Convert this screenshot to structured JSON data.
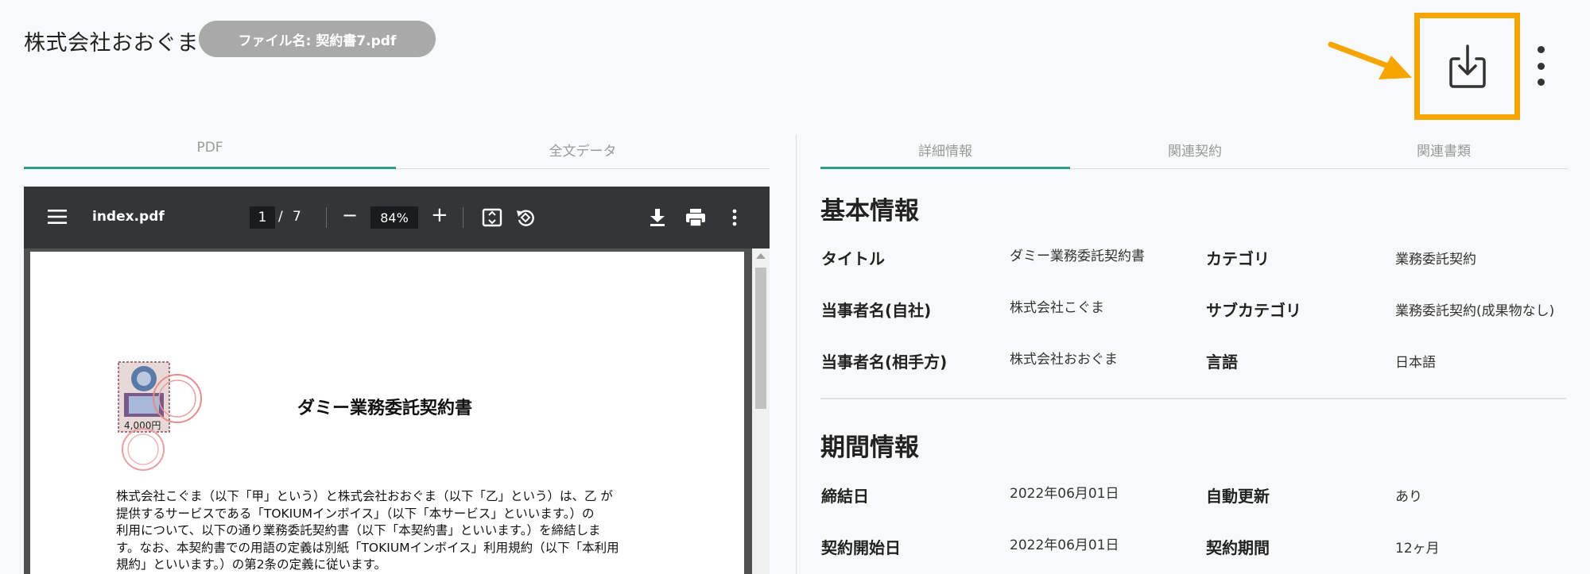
{
  "header": {
    "company": "株式会社おおぐま",
    "file_chip": "ファイル名: 契約書7.pdf"
  },
  "colors": {
    "accent_teal": "#2a9d8f",
    "highlight_orange": "#f6a400",
    "viewer_toolbar": "#323639"
  },
  "left_tabs": [
    {
      "label": "PDF"
    },
    {
      "label": "全文データ"
    }
  ],
  "right_tabs": [
    {
      "label": "詳細情報"
    },
    {
      "label": "関連契約"
    },
    {
      "label": "関連書類"
    }
  ],
  "viewer": {
    "filename": "index.pdf",
    "page_current": "1",
    "page_sep": "/",
    "page_total": "7",
    "zoom": "84%",
    "zoom_out": "−",
    "zoom_in": "+"
  },
  "pdf": {
    "stamp_value": "4,000円",
    "title": "ダミー業務委託契約書",
    "body": [
      "株式会社こぐま（以下「甲」という）と株式会社おおぐま（以下「乙」という）は、乙 が",
      "提供するサービスである「TOKIUMインボイス」（以下「本サービス」といいます。）の",
      "利用について、以下の通り業務委託契約書（以下「本契約書」といいます。）を締結しま",
      "す。なお、本契約書での用語の定義は別紙「TOKIUMインボイス」利用規約（以下「本利用",
      "規約」といいます。）の第2条の定義に従います。"
    ]
  },
  "basic_info": {
    "title": "基本情報",
    "rows": [
      {
        "l1": "タイトル",
        "v1": "ダミー業務委託契約書",
        "l2": "カテゴリ",
        "v2": "業務委託契約"
      },
      {
        "l1": "当事者名(自社)",
        "v1": "株式会社こぐま",
        "l2": "サブカテゴリ",
        "v2": "業務委託契約(成果物なし)"
      },
      {
        "l1": "当事者名(相手方)",
        "v1": "株式会社おおぐま",
        "l2": "言語",
        "v2": "日本語"
      }
    ]
  },
  "period_info": {
    "title": "期間情報",
    "rows": [
      {
        "l1": "締結日",
        "v1": "2022年06月01日",
        "l2": "自動更新",
        "v2": "あり"
      },
      {
        "l1": "契約開始日",
        "v1": "2022年06月01日",
        "l2": "契約期間",
        "v2": "12ヶ月"
      }
    ]
  }
}
